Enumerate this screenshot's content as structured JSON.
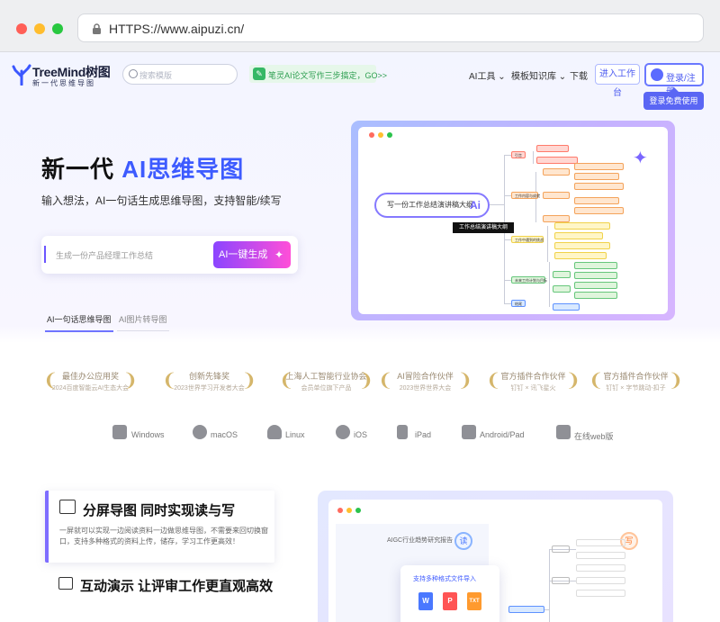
{
  "browser": {
    "url": "HTTPS://www.aipuzi.cn/"
  },
  "nav": {
    "logo_name": "TreeMind树图",
    "logo_sub": "新一代思维导图",
    "search_placeholder": "搜索模版",
    "promo": "笔灵AI论文写作三步搞定，GO>>",
    "items": [
      "AI工具",
      "模板知识库",
      "下载"
    ],
    "workspace": "进入工作台",
    "login": "登录/注册",
    "tooltip": "登录免费使用"
  },
  "hero": {
    "title_prefix": "新一代 ",
    "title_accent": "AI思维导图",
    "subtitle": "输入想法，AI一句话生成思维导图，支持智能/续写",
    "input_placeholder": "生成一份产品经理工作总结",
    "generate_button": "AI一键生成",
    "tabs": [
      "AI一句话思维导图",
      "AI图片转导图"
    ]
  },
  "mindmap": {
    "prompt": "写一份工作总结演讲稿大纲",
    "ai": "Ai",
    "tooltip": "工作总结演讲稿大纲",
    "nodes": [
      "引言",
      "工作内容与成就",
      "工作中遇到的挑战",
      "未来工作计划与目标",
      "结尾"
    ]
  },
  "awards": [
    {
      "title": "最佳办公应用奖",
      "sub": "2024百度智能云AI生态大会"
    },
    {
      "title": "创新先锋奖",
      "sub": "2023世界学习开发者大会"
    },
    {
      "title": "上海人工智能行业协会",
      "sub": "会员单位旗下产品"
    },
    {
      "title": "AI冒险合作伙伴",
      "sub": "2023世界世界大会"
    },
    {
      "title": "官方插件合作伙伴",
      "sub": "钉钉 × 讯飞星火"
    },
    {
      "title": "官方插件合作伙伴",
      "sub": "钉钉 × 字节跳动-扣子"
    }
  ],
  "platforms": [
    "Windows",
    "macOS",
    "Linux",
    "iOS",
    "iPad",
    "Android/Pad",
    "在线web版"
  ],
  "features": {
    "split_title": "分屏导图 同时实现读与写",
    "split_desc": "一屏就可以实现一边阅读资料一边做思维导图，不需要来回切换窗口，支持多种格式的资料上传，储存，学习工作更高效！",
    "demo_title": "互动演示 让评审工作更直观高效"
  },
  "demo": {
    "doc_title": "AIGC行业趋势研究报告",
    "read": "读",
    "write": "写",
    "import_title": "支持多种格式文件导入",
    "file_types": [
      "W",
      "P",
      "TXT"
    ]
  }
}
